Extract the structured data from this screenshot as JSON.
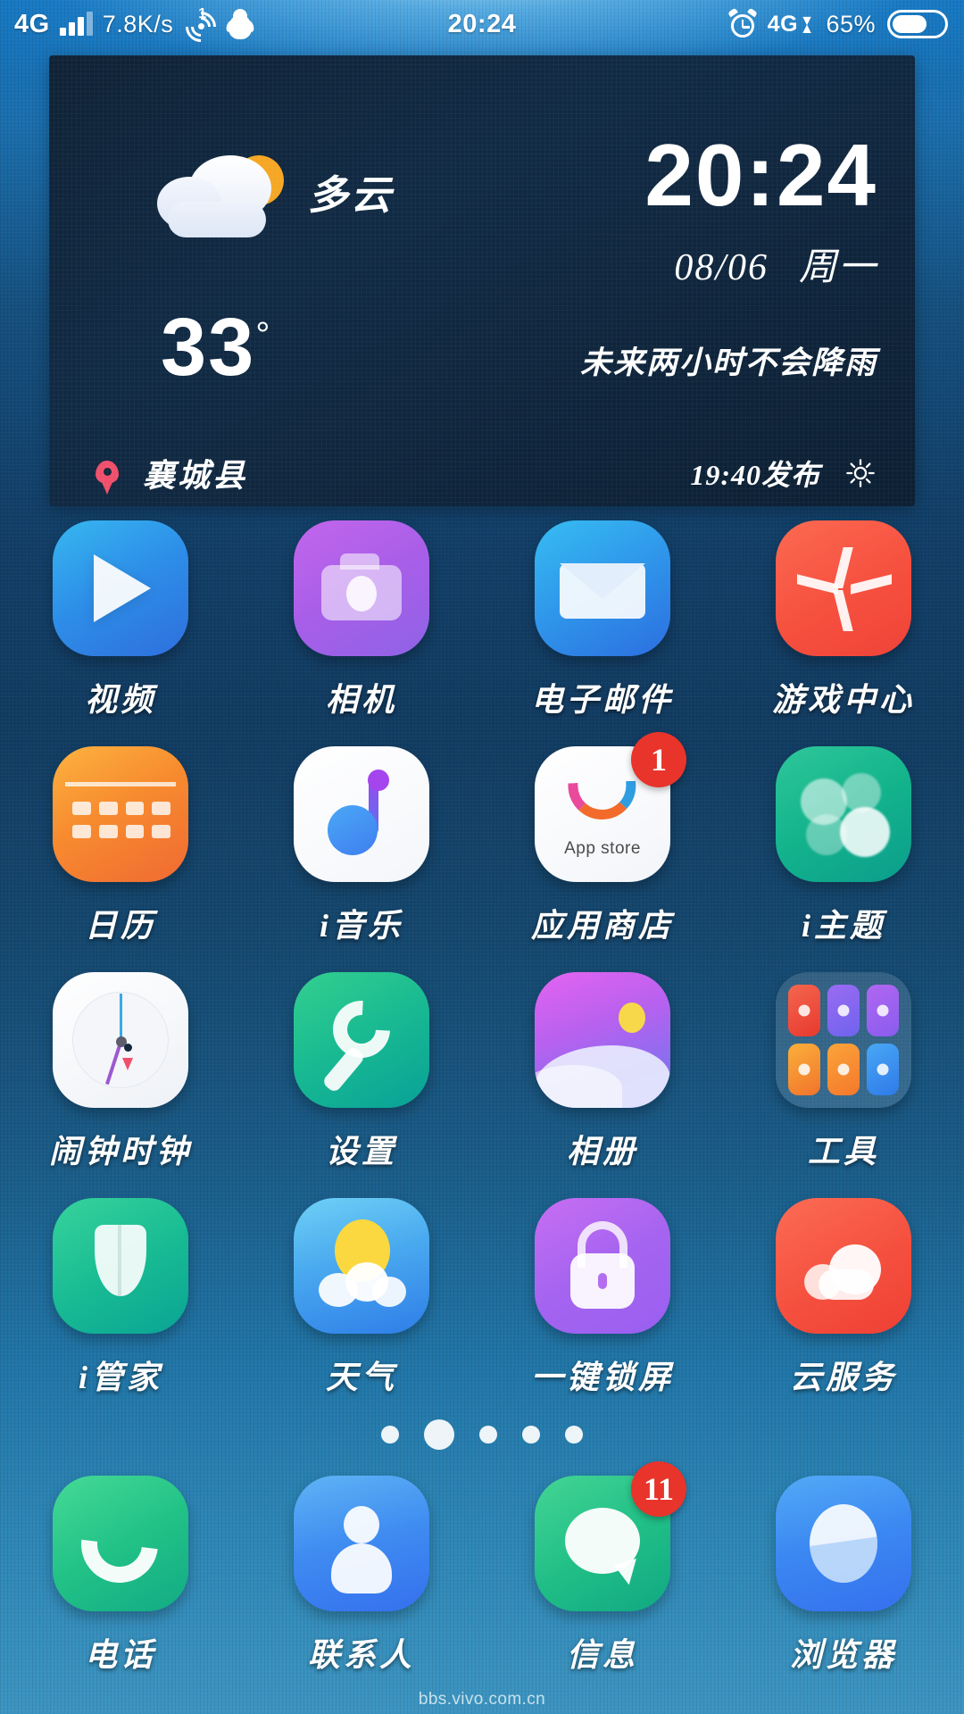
{
  "status_bar": {
    "network_label": "4G",
    "data_speed": "7.8K/s",
    "hotspot_count": "1",
    "clock": "20:24",
    "network_right": "4G",
    "battery_percent": "65%",
    "icons": [
      "signal-bars-icon",
      "hotspot-icon",
      "qq-penguin-icon",
      "alarm-clock-icon",
      "battery-icon"
    ]
  },
  "weather_widget": {
    "condition": "多云",
    "temperature": "33",
    "degree_symbol": "°",
    "clock": "20:24",
    "date": "08/06",
    "weekday": "周一",
    "forecast": "未来两小时不会降雨",
    "location": "襄城县",
    "published": "19:40发布",
    "settings_icon": "gear-icon",
    "weather_icon": "moon-cloudy-icon",
    "location_icon": "map-pin-icon"
  },
  "home_grid": {
    "rows": [
      [
        {
          "label": "视频",
          "icon": "video-player-icon",
          "badge": null
        },
        {
          "label": "相机",
          "icon": "camera-icon",
          "badge": null
        },
        {
          "label": "电子邮件",
          "icon": "email-envelope-icon",
          "badge": null
        },
        {
          "label": "游戏中心",
          "icon": "game-center-icon",
          "badge": null
        }
      ],
      [
        {
          "label": "日历",
          "icon": "calendar-icon",
          "badge": null
        },
        {
          "label": "i音乐",
          "icon": "music-note-icon",
          "badge": null
        },
        {
          "label": "应用商店",
          "icon": "app-store-icon",
          "badge": "1",
          "sublabel": "App store"
        },
        {
          "label": "i主题",
          "icon": "theme-bubbles-icon",
          "badge": null
        }
      ],
      [
        {
          "label": "闹钟时钟",
          "icon": "analog-clock-icon",
          "badge": null
        },
        {
          "label": "设置",
          "icon": "wrench-settings-icon",
          "badge": null
        },
        {
          "label": "相册",
          "icon": "photo-gallery-icon",
          "badge": null
        },
        {
          "label": "工具",
          "icon": "folder-tools-icon",
          "badge": null
        }
      ],
      [
        {
          "label": "i管家",
          "icon": "shield-manager-icon",
          "badge": null
        },
        {
          "label": "天气",
          "icon": "sun-cloud-icon",
          "badge": null
        },
        {
          "label": "一键锁屏",
          "icon": "padlock-icon",
          "badge": null
        },
        {
          "label": "云服务",
          "icon": "cloud-service-icon",
          "badge": null
        }
      ]
    ]
  },
  "page_indicator": {
    "total": 5,
    "active_index": 1
  },
  "dock": {
    "items": [
      {
        "label": "电话",
        "icon": "phone-handset-icon",
        "badge": null
      },
      {
        "label": "联系人",
        "icon": "contacts-person-icon",
        "badge": null
      },
      {
        "label": "信息",
        "icon": "message-bubble-icon",
        "badge": "11"
      },
      {
        "label": "浏览器",
        "icon": "browser-compass-icon",
        "badge": null
      }
    ]
  },
  "watermark": "bbs.vivo.com.cn",
  "colors": {
    "accent_badge": "#e8342a",
    "location_pin": "#ef4f6b",
    "widget_bg": "#112a44",
    "wallpaper_top": "#1273bd",
    "wallpaper_bottom": "#3c94c0"
  }
}
